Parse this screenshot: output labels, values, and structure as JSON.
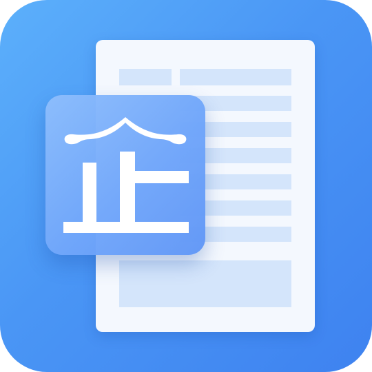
{
  "icon": {
    "name": "enterprise-document-app-icon",
    "badge_character": "企",
    "colors": {
      "background_start": "#5cb0fb",
      "background_end": "#3e82f0",
      "sheet": "#f4f8fe",
      "sheet_lines": "#d4e5fb",
      "badge": "#7fb1fa",
      "glyph": "#ffffff"
    }
  }
}
